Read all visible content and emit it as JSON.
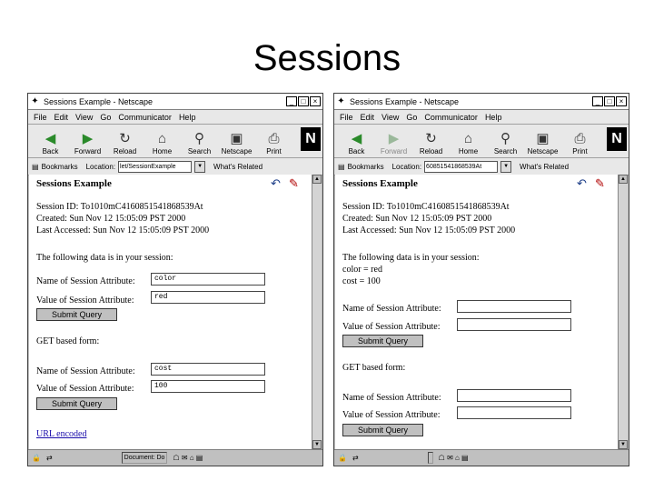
{
  "slide": {
    "title": "Sessions"
  },
  "windows": [
    {
      "title": "Sessions Example - Netscape",
      "menu": [
        "File",
        "Edit",
        "View",
        "Go",
        "Communicator",
        "Help"
      ],
      "toolbar": [
        {
          "label": "Back",
          "icon": "back-arrow-icon"
        },
        {
          "label": "Forward",
          "icon": "forward-arrow-icon"
        },
        {
          "label": "Reload",
          "icon": "reload-icon"
        },
        {
          "label": "Home",
          "icon": "home-icon"
        },
        {
          "label": "Search",
          "icon": "search-icon"
        },
        {
          "label": "Netscape",
          "icon": "netscape-icon"
        },
        {
          "label": "Print",
          "icon": "print-icon"
        }
      ],
      "bookmarks": "Bookmarks",
      "location_label": "Location:",
      "location_value": "let/SessionExample",
      "whats_related": "What's Related",
      "page_title": "Sessions Example",
      "session_id": "Session ID: To1010mC4160851541868539At",
      "created": "Created: Sun Nov 12 15:05:09 PST 2000",
      "last_accessed": "Last Accessed: Sun Nov 12 15:05:09 PST 2000",
      "data_intro": "The following data is in your session:",
      "data_lines": [],
      "name_label": "Name of Session Attribute:",
      "value_label": "Value of Session Attribute:",
      "name_value": "color",
      "value_value": "red",
      "submit_label": "Submit Query",
      "get_form": "GET based form:",
      "name2_value": "cost",
      "value2_value": "100",
      "url_encoded": "URL encoded",
      "status_text": "Document: Do"
    },
    {
      "title": "Sessions Example - Netscape",
      "menu": [
        "File",
        "Edit",
        "View",
        "Go",
        "Communicator",
        "Help"
      ],
      "toolbar": [
        {
          "label": "Back",
          "icon": "back-arrow-icon"
        },
        {
          "label": "Forward",
          "icon": "forward-arrow-icon"
        },
        {
          "label": "Reload",
          "icon": "reload-icon"
        },
        {
          "label": "Home",
          "icon": "home-icon"
        },
        {
          "label": "Search",
          "icon": "search-icon"
        },
        {
          "label": "Netscape",
          "icon": "netscape-icon"
        },
        {
          "label": "Print",
          "icon": "print-icon"
        }
      ],
      "bookmarks": "Bookmarks",
      "location_label": "Location:",
      "location_value": "60851541868539At",
      "whats_related": "What's Related",
      "page_title": "Sessions Example",
      "session_id": "Session ID: To1010mC4160851541868539At",
      "created": "Created: Sun Nov 12 15:05:09 PST 2000",
      "last_accessed": "Last Accessed: Sun Nov 12 15:05:09 PST 2000",
      "data_intro": "The following data is in your session:",
      "data_lines": [
        "color = red",
        "cost = 100"
      ],
      "name_label": "Name of Session Attribute:",
      "value_label": "Value of Session Attribute:",
      "name_value": "",
      "value_value": "",
      "submit_label": "Submit Query",
      "get_form": "GET based form:",
      "name2_value": "",
      "value2_value": "",
      "status_text": ""
    }
  ]
}
